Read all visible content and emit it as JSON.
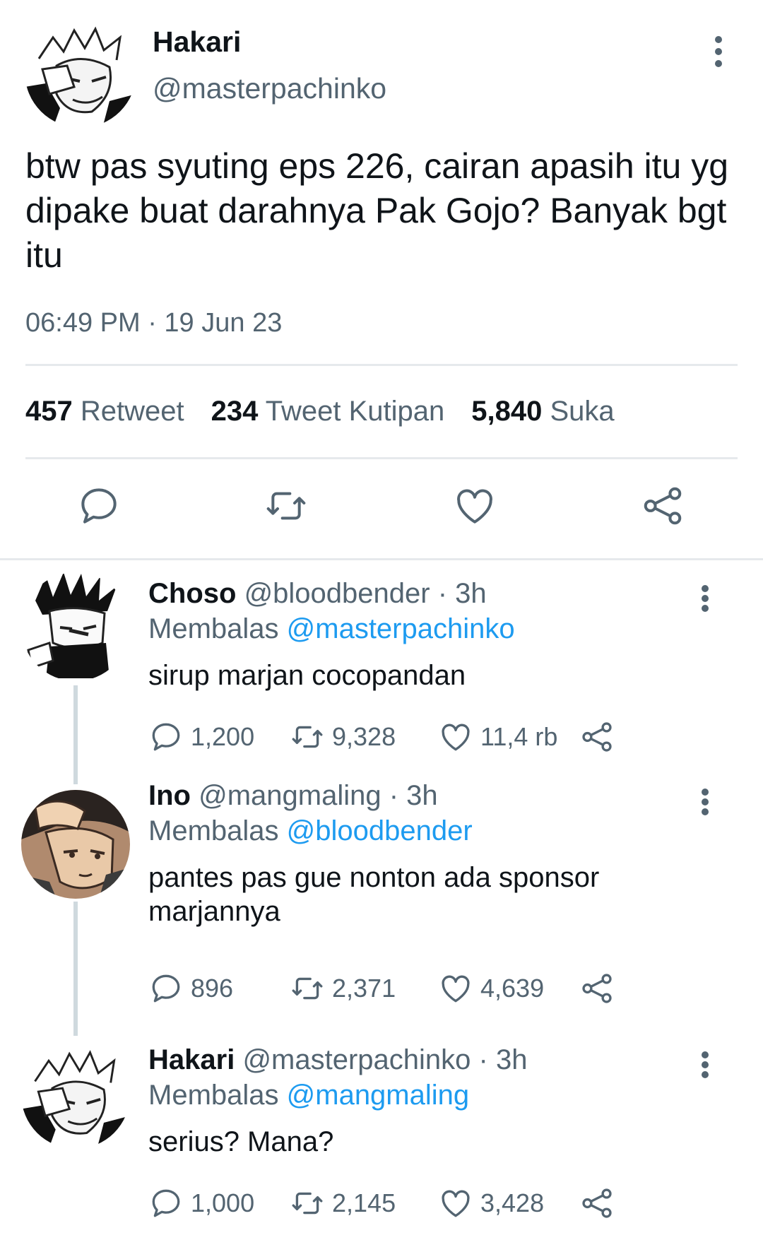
{
  "main_tweet": {
    "author_name": "Hakari",
    "author_handle": "@masterpachinko",
    "text": "btw pas syuting eps 226, cairan apasih itu yg dipake buat darahnya Pak Gojo? Banyak bgt itu",
    "timestamp": "06:49 PM · 19 Jun 23",
    "stats": {
      "retweets_count": "457",
      "retweets_label": "Retweet",
      "quotes_count": "234",
      "quotes_label": "Tweet Kutipan",
      "likes_count": "5,840",
      "likes_label": "Suka"
    },
    "actions": [
      "reply-icon",
      "retweet-icon",
      "like-icon",
      "share-icon"
    ]
  },
  "replies": [
    {
      "name": "Choso",
      "meta": "@bloodbender · 3h",
      "replying_label": "Membalas",
      "replying_to": "@masterpachinko",
      "text": "sirup marjan cocopandan",
      "replies": "1,200",
      "retweets": "9,328",
      "likes": "11,4 rb"
    },
    {
      "name": "Ino",
      "meta": "@mangmaling · 3h",
      "replying_label": "Membalas",
      "replying_to": "@bloodbender",
      "text": "pantes pas gue nonton ada sponsor marjannya",
      "replies": "896",
      "retweets": "2,371",
      "likes": "4,639"
    },
    {
      "name": "Hakari",
      "meta": "@masterpachinko · 3h",
      "replying_label": "Membalas",
      "replying_to": "@mangmaling",
      "text": "serius? Mana?",
      "replies": "1,000",
      "retweets": "2,145",
      "likes": "3,428"
    }
  ],
  "colors": {
    "text": "#0f1419",
    "secondary": "#536471",
    "mention": "#1d9bf0",
    "divider": "#e6e9ec",
    "thread_line": "#cfd9de"
  }
}
